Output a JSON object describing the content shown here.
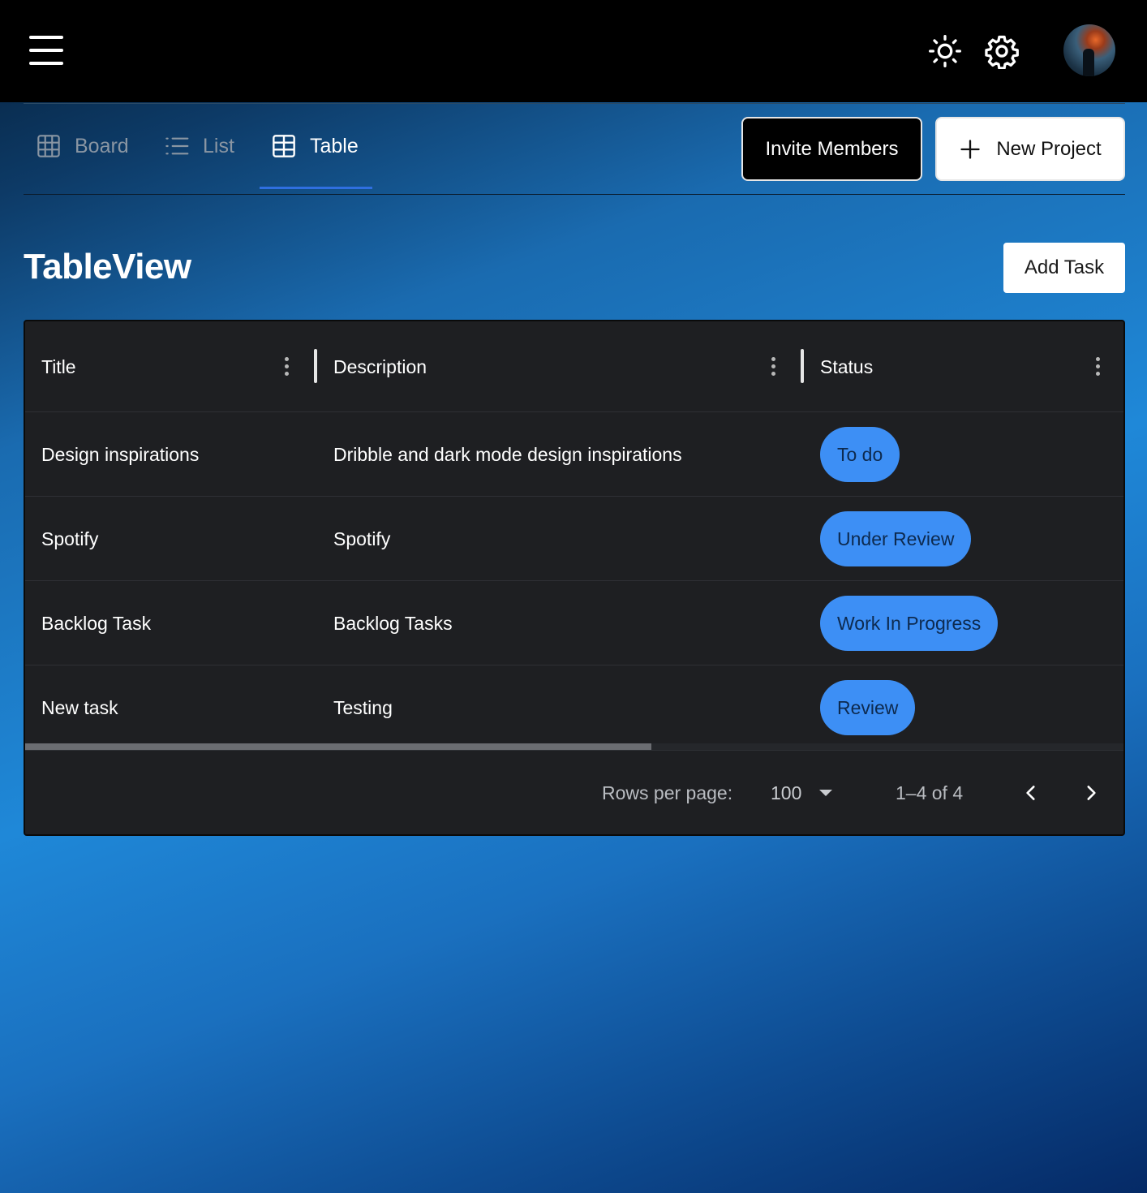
{
  "header": {
    "menu_icon": "hamburger-menu-icon",
    "theme_icon": "sun-icon",
    "settings_icon": "gear-icon",
    "avatar_icon": "user-avatar"
  },
  "tabs": [
    {
      "label": "Board",
      "icon": "grid-icon",
      "active": false
    },
    {
      "label": "List",
      "icon": "list-icon",
      "active": false
    },
    {
      "label": "Table",
      "icon": "table-icon",
      "active": true
    }
  ],
  "actions": {
    "invite_label": "Invite Members",
    "new_project_label": "New Project"
  },
  "page": {
    "title": "TableView",
    "add_task_label": "Add Task"
  },
  "table": {
    "columns": [
      "Title",
      "Description",
      "Status"
    ],
    "rows": [
      {
        "title": "Design inspirations",
        "description": "Dribble and dark mode design inspirations",
        "status": "To do"
      },
      {
        "title": "Spotify",
        "description": "Spotify",
        "status": "Under Review"
      },
      {
        "title": "Backlog Task",
        "description": "Backlog Tasks",
        "status": "Work In Progress"
      },
      {
        "title": "New task",
        "description": "Testing",
        "status": "Review"
      }
    ],
    "footer": {
      "rows_per_page_label": "Rows per page:",
      "rows_per_page_value": "100",
      "range": "1–4 of 4"
    }
  },
  "colors": {
    "accent": "#2f6fe0",
    "chip": "#3d8ff5",
    "grid_bg": "#1e1f22"
  }
}
